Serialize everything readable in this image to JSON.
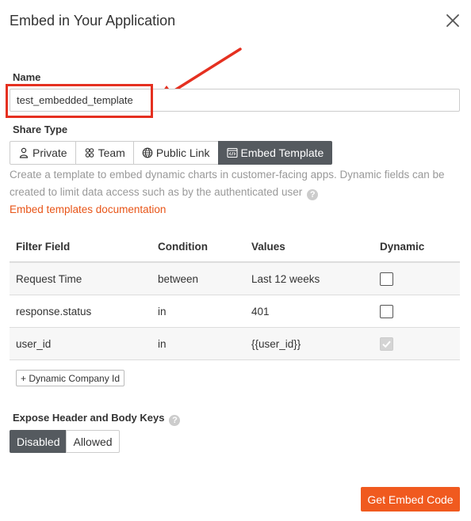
{
  "dialog": {
    "title": "Embed in Your Application"
  },
  "name": {
    "label": "Name",
    "value": "test_embedded_template"
  },
  "share_type": {
    "label": "Share Type",
    "options": [
      {
        "label": "Private",
        "icon": "person-icon",
        "active": false
      },
      {
        "label": "Team",
        "icon": "team-icon",
        "active": false
      },
      {
        "label": "Public Link",
        "icon": "globe-icon",
        "active": false
      },
      {
        "label": "Embed Template",
        "icon": "code-icon",
        "active": true
      }
    ]
  },
  "description": "Create a template to embed dynamic charts in customer-facing apps. Dynamic fields can be created to limit data access such as by the authenticated user",
  "doc_link": "Embed templates documentation",
  "filters": {
    "headers": [
      "Filter Field",
      "Condition",
      "Values",
      "Dynamic"
    ],
    "rows": [
      {
        "field": "Request Time",
        "condition": "between",
        "value": "Last 12 weeks",
        "dynamic": false
      },
      {
        "field": "response.status",
        "condition": "in",
        "value": "401",
        "dynamic": false
      },
      {
        "field": "user_id",
        "condition": "in",
        "value": "{{user_id}}",
        "dynamic": true
      }
    ]
  },
  "dynamic_button": "+ Dynamic Company Id",
  "expose": {
    "label": "Expose Header and Body Keys",
    "options": [
      "Disabled",
      "Allowed"
    ],
    "selected": "Disabled"
  },
  "submit_label": "Get Embed Code",
  "colors": {
    "accent": "#f05a1f",
    "highlight": "#e53020",
    "active": "#555a5f",
    "link": "#e85518"
  }
}
